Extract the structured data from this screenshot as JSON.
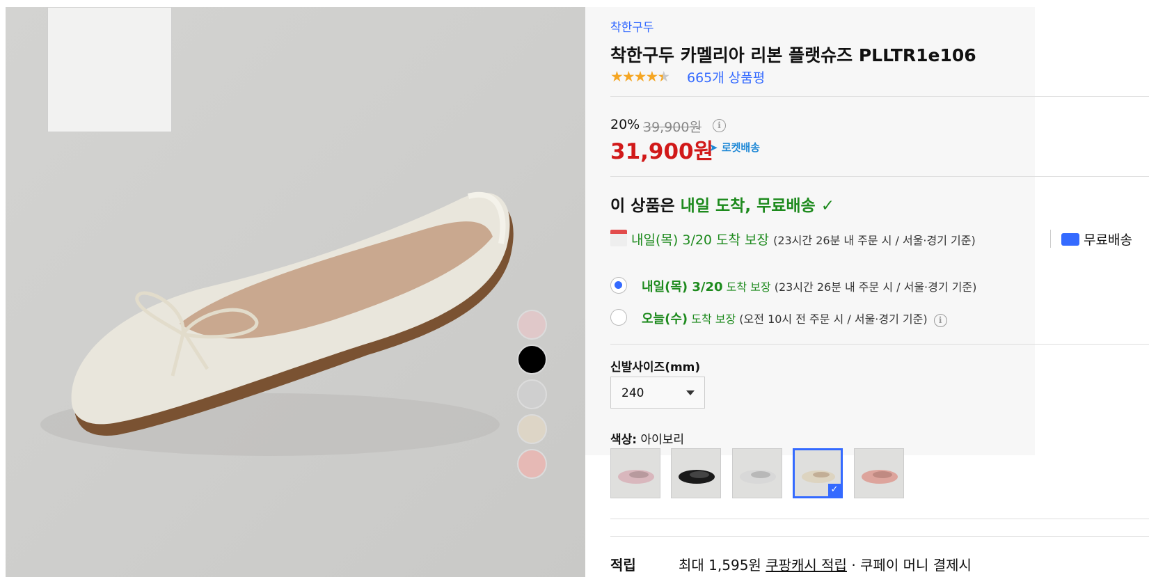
{
  "product": {
    "brand": "착한구두",
    "title": "착한구두 카멜리아 리본 플랫슈즈 PLLTR1e106",
    "rating_stars": 4.5,
    "review_count": "665개 상품평"
  },
  "price": {
    "discount_rate": "20%",
    "original_price": "39,900원",
    "sale_price": "31,900원",
    "rocket_label": "로켓배송"
  },
  "delivery": {
    "headline_prefix": "이 상품은",
    "headline_highlight": "내일 도착, 무료배송",
    "detail_main": "내일(목) 3/20 도착 보장",
    "detail_note": "(23시간 26분  내 주문 시 / 서울·경기 기준)",
    "free_shipping": "무료배송",
    "options": [
      {
        "day": "내일(목) 3/20",
        "guarantee": "도착 보장",
        "note": "(23시간 26분 내 주문 시 / 서울·경기 기준)",
        "selected": true
      },
      {
        "day": "오늘(수)",
        "guarantee": "도착 보장",
        "note": "(오전 10시 전 주문 시 / 서울·경기 기준)",
        "selected": false
      }
    ]
  },
  "size": {
    "label": "신발사이즈(mm)",
    "selected": "240"
  },
  "color": {
    "label": "색상:",
    "selected": "아이보리",
    "options": [
      "#d9b7bd",
      "#1a1a1a",
      "#d8d8d8",
      "#ddd4c0",
      "#dda49c"
    ]
  },
  "swatch_dots": [
    "#e0c8c9",
    "#000000",
    "#cfcfcf",
    "#ddd5c6",
    "#e6b9b5"
  ],
  "reward": {
    "label": "적립",
    "text_prefix": "최대 1,595원",
    "link": "쿠팡캐시 적립",
    "text_suffix": "· 쿠페이 머니 결제시"
  },
  "colors": {
    "link_blue": "#346aff",
    "price_red": "#d11919",
    "delivery_green": "#1d8a1d",
    "star_orange": "#f5a623"
  }
}
